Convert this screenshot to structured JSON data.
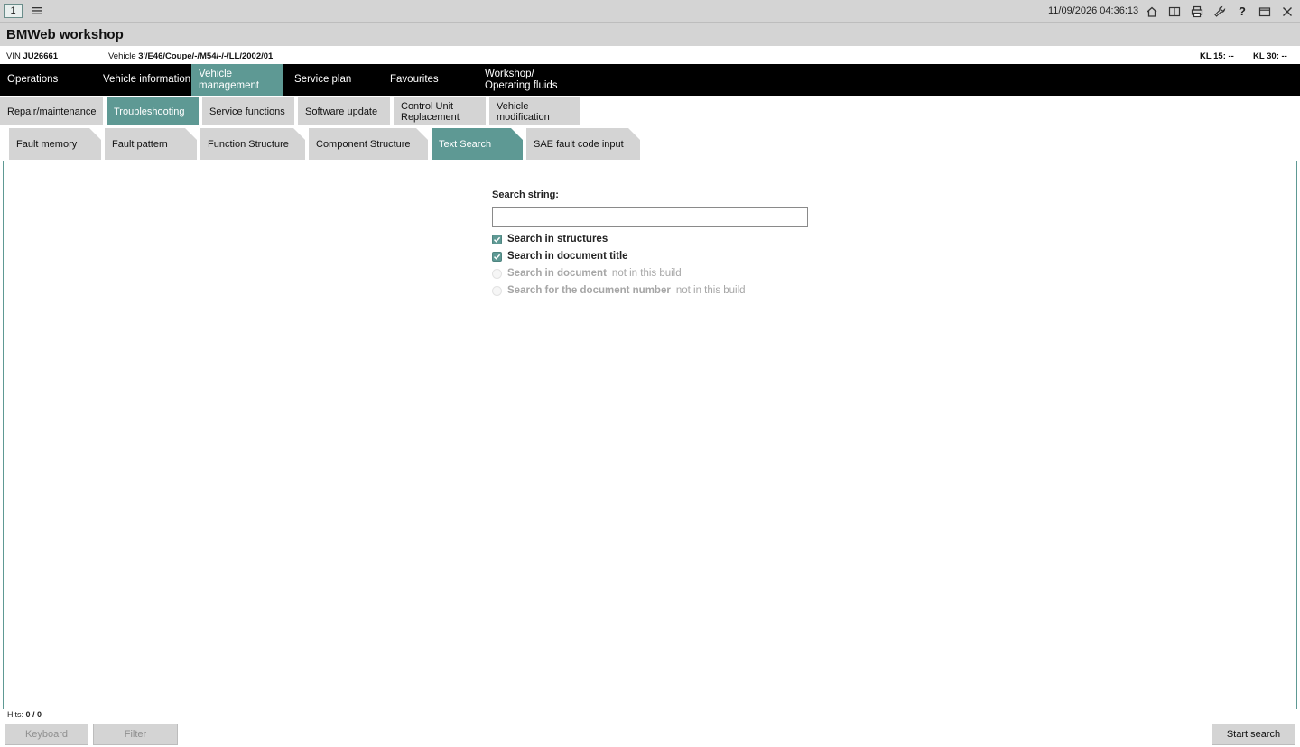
{
  "topbar": {
    "window_number": "1",
    "datetime": "11/09/2026 04:36:13",
    "help_glyph": "?"
  },
  "app": {
    "title": "BMWeb workshop"
  },
  "vehicle": {
    "vin_label": "VIN",
    "vin": "JU26661",
    "vehicle_label": "Vehicle",
    "vehicle_desc": "3'/E46/Coupe/-/M54/-/-/LL/2002/01",
    "kl15": "KL 15: --",
    "kl30": "KL 30: --"
  },
  "main_nav": [
    {
      "label": "Operations"
    },
    {
      "label": "Vehicle information"
    },
    {
      "label": "Vehicle management"
    },
    {
      "label": "Service plan"
    },
    {
      "label": "Favourites"
    },
    {
      "label": "Workshop/ Operating fluids"
    }
  ],
  "sub_nav": [
    {
      "label": "Repair/maintenance"
    },
    {
      "label": "Troubleshooting"
    },
    {
      "label": "Service functions"
    },
    {
      "label": "Software update"
    },
    {
      "label": "Control Unit Replacement"
    },
    {
      "label": "Vehicle modification"
    }
  ],
  "tabs": [
    {
      "label": "Fault memory"
    },
    {
      "label": "Fault pattern"
    },
    {
      "label": "Function Structure"
    },
    {
      "label": "Component Structure"
    },
    {
      "label": "Text Search"
    },
    {
      "label": "SAE fault code input"
    }
  ],
  "search": {
    "label": "Search string:",
    "value": "",
    "options": [
      {
        "label": "Search in structures",
        "checked": true,
        "note": ""
      },
      {
        "label": "Search in document title",
        "checked": true,
        "note": ""
      },
      {
        "label": "Search in document",
        "checked": false,
        "note": "not in this build"
      },
      {
        "label": "Search for the document number",
        "checked": false,
        "note": "not in this build"
      }
    ]
  },
  "footer": {
    "hits_label": "Hits:",
    "hits_value": "0 / 0",
    "keyboard_button": "Keyboard",
    "filter_button": "Filter",
    "start_search_button": "Start search"
  },
  "colors": {
    "accent": "#5e9994",
    "nav_bg": "#000000",
    "bar_bg": "#d4d4d4"
  }
}
